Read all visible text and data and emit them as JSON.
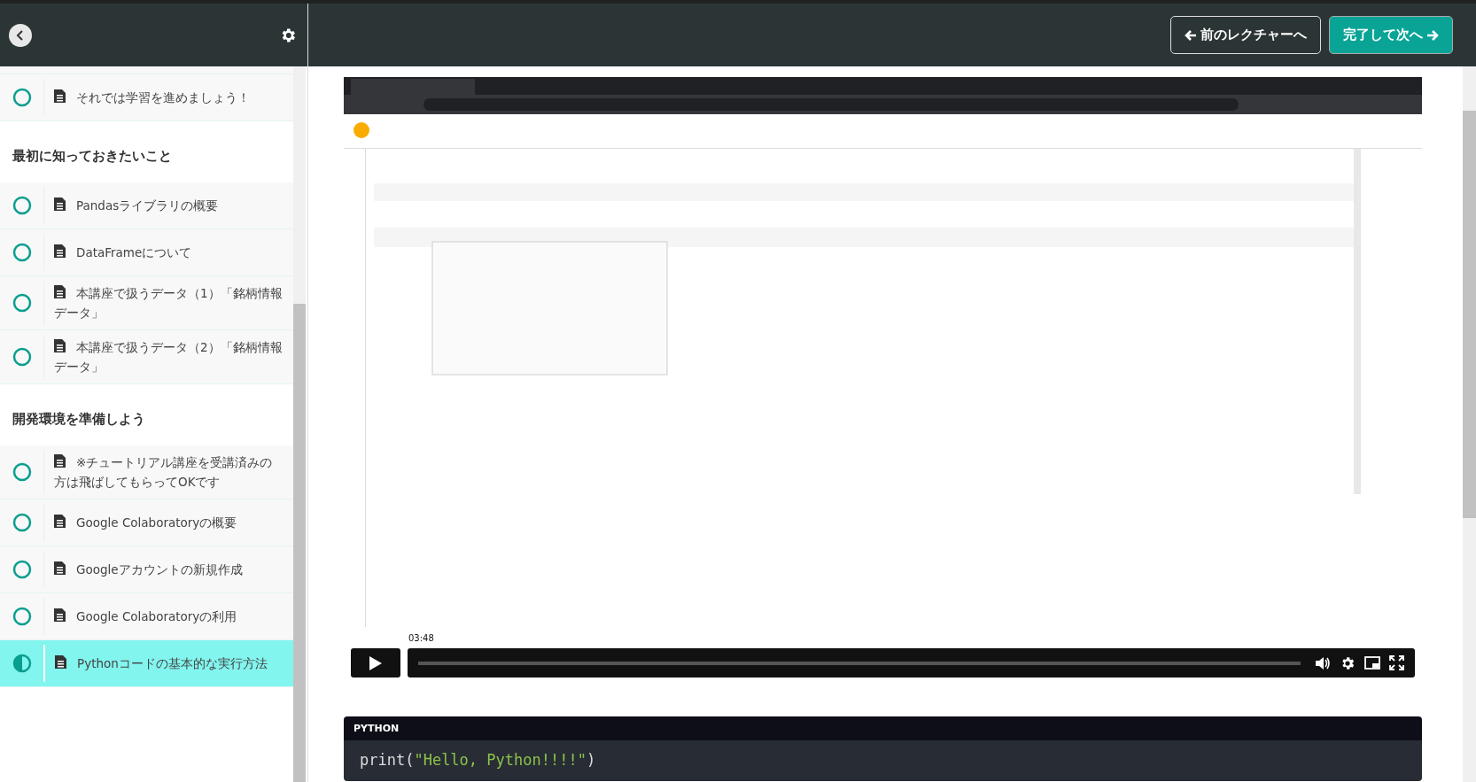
{
  "header": {
    "buttons": [
      {
        "label": "前のレクチャーへ",
        "kind": "prev"
      },
      {
        "label": "完了して次へ",
        "kind": "next"
      }
    ]
  },
  "sidebar": {
    "sections": [
      {
        "items": [
          {
            "title": "それでは学習を進めましょう！",
            "in_progress": false,
            "selected": false
          }
        ]
      },
      {
        "title": "最初に知っておきたいこと",
        "items": [
          {
            "title": "Pandasライブラリの概要",
            "in_progress": false,
            "selected": false
          },
          {
            "title": "DataFrameについて",
            "in_progress": false,
            "selected": false
          },
          {
            "title": "本講座で扱うデータ（1）「銘柄情報データ」",
            "in_progress": false,
            "selected": false
          },
          {
            "title": "本講座で扱うデータ（2）「銘柄情報データ」",
            "in_progress": false,
            "selected": false
          }
        ]
      },
      {
        "title": "開発環境を準備しよう",
        "items": [
          {
            "title": "※チュートリアル講座を受講済みの方は飛ばしてもらってOKです",
            "in_progress": false,
            "selected": false
          },
          {
            "title": "Google Colaboratoryの概要",
            "in_progress": false,
            "selected": false
          },
          {
            "title": "Googleアカウントの新規作成",
            "in_progress": false,
            "selected": false
          },
          {
            "title": "Google Colaboratoryの利用",
            "in_progress": false,
            "selected": false
          },
          {
            "title": "Pythonコードの基本的な実行方法",
            "in_progress": true,
            "selected": true
          }
        ]
      }
    ]
  },
  "video": {
    "kind": "picture",
    "hover_time": "03:48"
  },
  "code_block": {
    "language": "PYTHON",
    "tokens": [
      {
        "kind": "plain",
        "text": "print("
      },
      {
        "kind": "string",
        "text": "\"Hello, Python!!!!\""
      },
      {
        "kind": "plain",
        "text": ")"
      }
    ]
  }
}
